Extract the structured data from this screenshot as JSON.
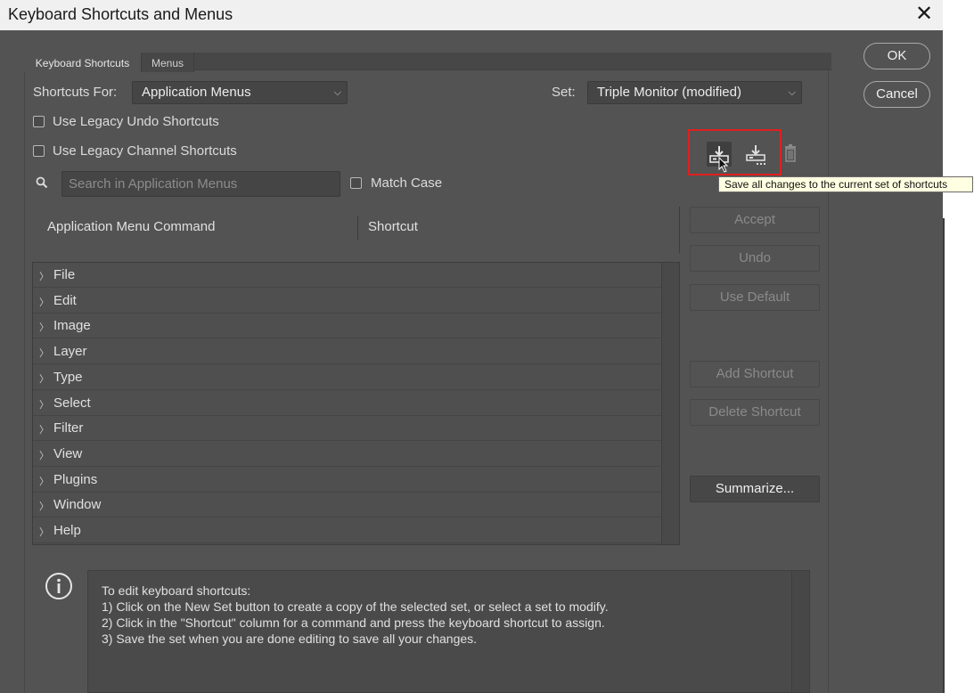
{
  "window": {
    "title": "Keyboard Shortcuts and Menus",
    "close_glyph": "✕"
  },
  "tabs": [
    {
      "label": "Keyboard Shortcuts",
      "active": true
    },
    {
      "label": "Menus",
      "active": false
    }
  ],
  "shortcuts_for": {
    "label": "Shortcuts For:",
    "value": "Application Menus"
  },
  "set": {
    "label": "Set:",
    "value": "Triple Monitor (modified)"
  },
  "options": {
    "legacy_undo": {
      "label": "Use Legacy Undo Shortcuts",
      "checked": false
    },
    "legacy_channel": {
      "label": "Use Legacy Channel Shortcuts",
      "checked": false
    },
    "match_case": {
      "label": "Match Case",
      "checked": false
    }
  },
  "search": {
    "placeholder": "Search in Application Menus",
    "value": ""
  },
  "set_tools": {
    "save_set_icon": "save-set-icon",
    "save_as_icon": "save-as-set-icon",
    "delete_icon": "trash-icon",
    "tooltip": "Save all changes to the current set of shortcuts"
  },
  "columns": {
    "command": "Application Menu Command",
    "shortcut": "Shortcut"
  },
  "menu_items": [
    "File",
    "Edit",
    "Image",
    "Layer",
    "Type",
    "Select",
    "Filter",
    "View",
    "Plugins",
    "Window",
    "Help"
  ],
  "side_buttons": {
    "accept": "Accept",
    "undo": "Undo",
    "use_default": "Use Default",
    "add_shortcut": "Add Shortcut",
    "delete_shortcut": "Delete Shortcut",
    "summarize": "Summarize..."
  },
  "dialog_buttons": {
    "ok": "OK",
    "cancel": "Cancel"
  },
  "info": {
    "lines": [
      "To edit keyboard shortcuts:",
      "1) Click on the New Set button to create a copy of the selected set, or select a set to modify.",
      "2) Click in the \"Shortcut\" column for a command and press the keyboard shortcut to assign.",
      "3) Save the set when you are done editing to save all your changes."
    ]
  },
  "colors": {
    "dialog_bg": "#535353",
    "highlight_box": "#e01f1f",
    "tooltip_bg": "#ffffe1"
  }
}
